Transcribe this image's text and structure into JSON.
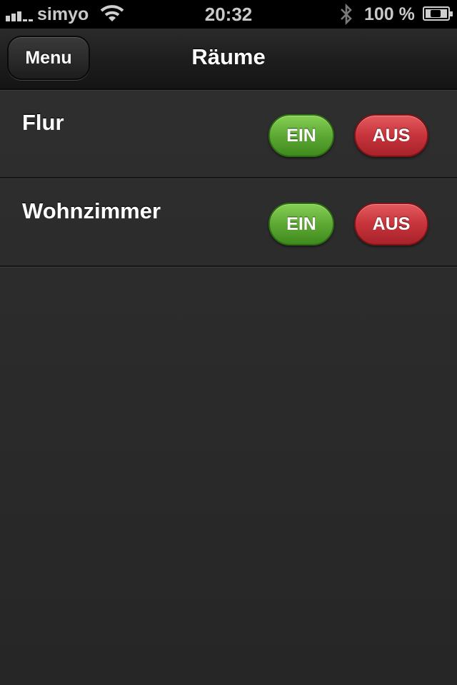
{
  "status_bar": {
    "carrier": "simyo",
    "time": "20:32",
    "battery_percent": "100 %",
    "icons": [
      "signal-icon",
      "wifi-icon",
      "bluetooth-icon",
      "battery-charging-icon"
    ]
  },
  "navbar": {
    "menu_label": "Menu",
    "title": "Räume"
  },
  "rooms": [
    {
      "name": "Flur",
      "on_label": "EIN",
      "off_label": "AUS"
    },
    {
      "name": "Wohnzimmer",
      "on_label": "EIN",
      "off_label": "AUS"
    }
  ],
  "colors": {
    "on_button": "#5ea935",
    "off_button": "#c7343b",
    "background": "#2c2c2c"
  }
}
